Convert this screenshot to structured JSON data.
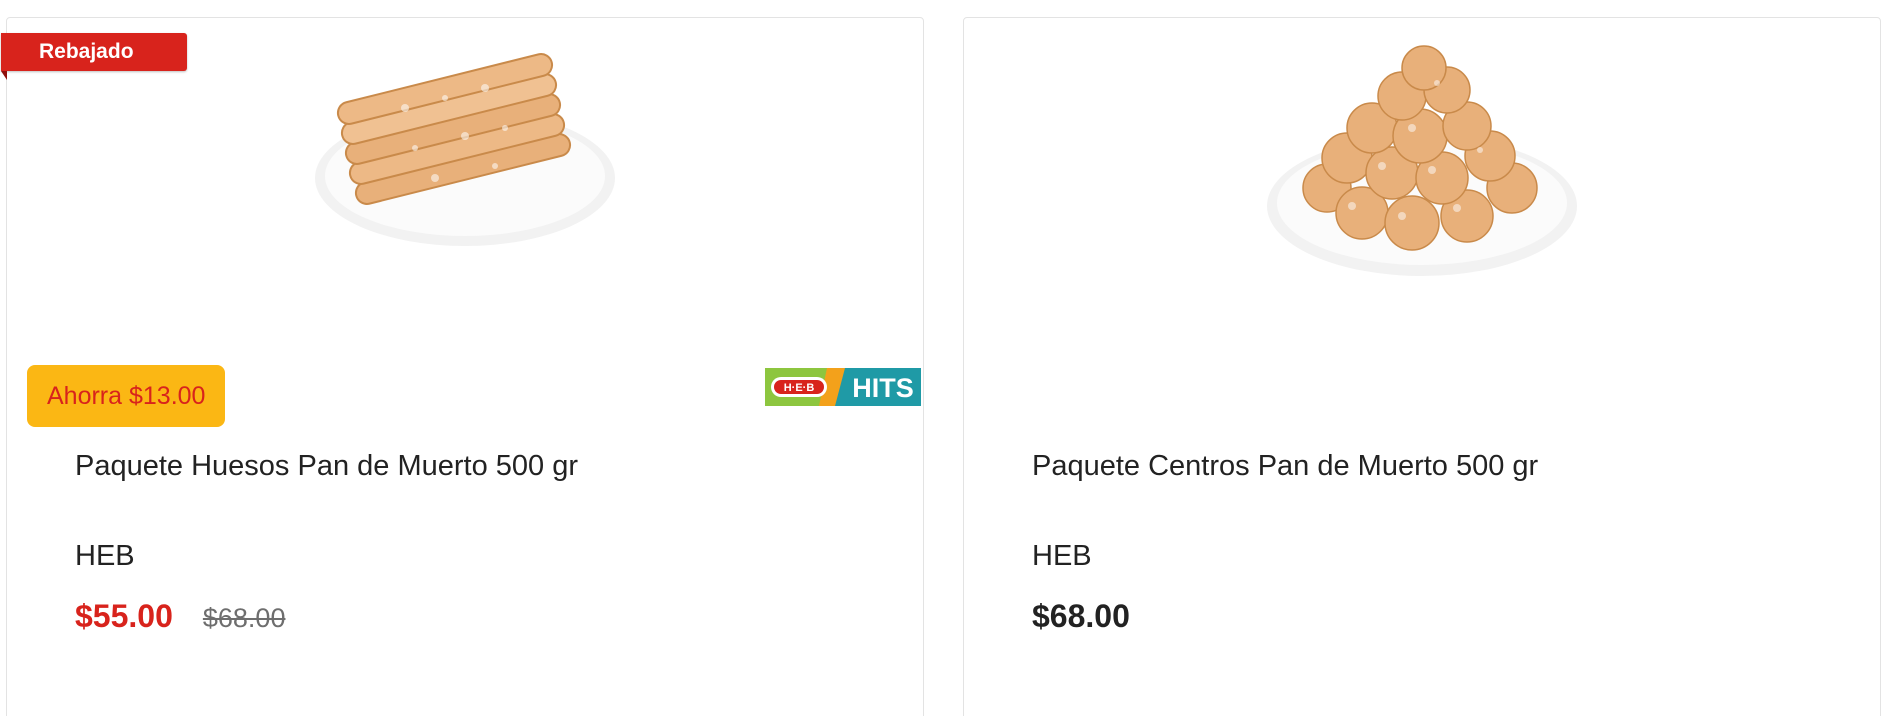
{
  "colors": {
    "sale_red": "#d8231c",
    "save_yellow": "#fbb714",
    "text": "#222222",
    "muted": "#6e6e6e"
  },
  "products": [
    {
      "ribbon": "Rebajado",
      "image": "pan-de-muerto-huesos-image",
      "save_label": "Ahorra $13.00",
      "promo_logo": "heb-hits-logo",
      "name": "Paquete Huesos Pan de Muerto 500 gr",
      "brand": "HEB",
      "price": "$55.00",
      "old_price": "$68.00"
    },
    {
      "image": "pan-de-muerto-centros-image",
      "name": "Paquete Centros Pan de Muerto 500 gr",
      "brand": "HEB",
      "price": "$68.00"
    }
  ]
}
